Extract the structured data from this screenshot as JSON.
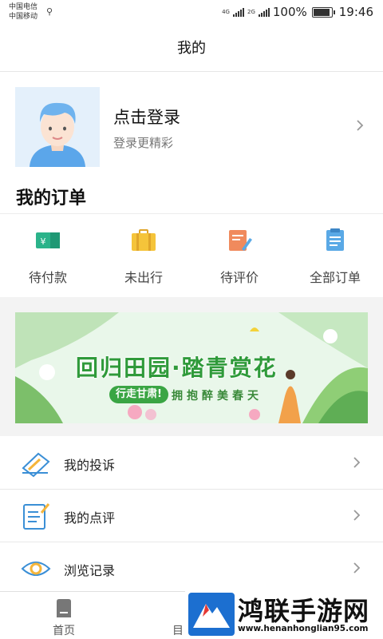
{
  "status_bar": {
    "carrier1": "中国电信",
    "carrier2": "中国移动",
    "net1": "4G",
    "net2": "2G",
    "battery_text": "100%",
    "time": "19:46",
    "battery_level": 1.0
  },
  "header": {
    "title": "我的"
  },
  "profile": {
    "login_title": "点击登录",
    "login_subtitle": "登录更精彩"
  },
  "orders": {
    "title": "我的订单",
    "items": [
      {
        "label": "待付款",
        "icon": "ticket-icon",
        "color": "#2bb38a"
      },
      {
        "label": "未出行",
        "icon": "suitcase-icon",
        "color": "#f5c43a"
      },
      {
        "label": "待评价",
        "icon": "note-pen-icon",
        "color": "#f08a5d"
      },
      {
        "label": "全部订单",
        "icon": "orders-list-icon",
        "color": "#5aa9e6"
      }
    ]
  },
  "banner": {
    "title": "回归田园·踏青赏花",
    "tag": "行走甘肃!",
    "subtitle": "拥抱醉美春天"
  },
  "menu": [
    {
      "label": "我的投诉",
      "icon": "complaint-icon"
    },
    {
      "label": "我的点评",
      "icon": "review-icon"
    },
    {
      "label": "浏览记录",
      "icon": "eye-icon"
    }
  ],
  "tabbar": {
    "home": "首页",
    "second": "目"
  },
  "watermark": {
    "text": "鸿联手游网",
    "url": "www.henanhonglian95.com"
  },
  "colors": {
    "accent_green": "#2f9a3a",
    "avatar_bg": "#e4f0fb"
  }
}
